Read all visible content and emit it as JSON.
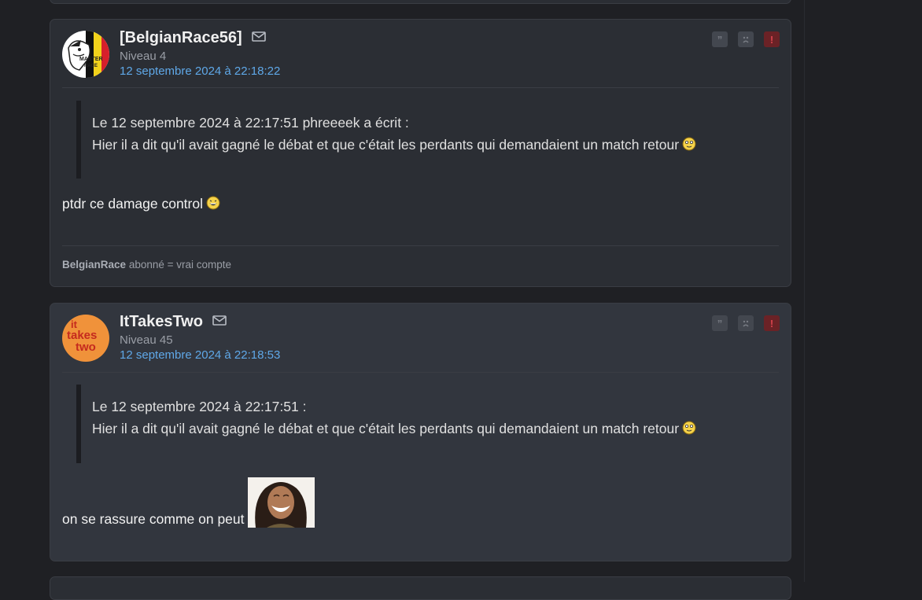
{
  "posts": [
    {
      "username": "[BelgianRace56]",
      "level": "Niveau 4",
      "date": "12 septembre 2024 à 22:18:22",
      "avatar_text": [
        "MASTER",
        "RACE"
      ],
      "quote_header": "Le 12 septembre 2024 à 22:17:51 phreeeek a écrit :",
      "quote_text": "Hier il a dit qu'il avait gagné le débat et que c'était les perdants qui demandaient un match retour",
      "message": "ptdr ce damage control",
      "signature_bold": "BelgianRace",
      "signature_rest": "abonné = vrai compte"
    },
    {
      "username": "ItTakesTwo",
      "level": "Niveau 45",
      "date": "12 septembre 2024 à 22:18:53",
      "avatar_text": [
        "it",
        "takes",
        "two"
      ],
      "quote_header": "Le 12 septembre 2024 à 22:17:51 :",
      "quote_text": "Hier il a dit qu'il avait gagné le débat et que c'était les perdants qui demandaient un match retour",
      "message": "on se rassure comme on peut"
    }
  ],
  "actions": {
    "quote": "”",
    "report": "!"
  },
  "colors": {
    "link": "#5fa8e8",
    "alert": "#d8434d",
    "background": "#1f2024"
  },
  "icons": [
    "mail-icon",
    "quote-icon",
    "sad-face-icon",
    "alert-icon",
    "smiley-icon",
    "laugh-icon"
  ]
}
